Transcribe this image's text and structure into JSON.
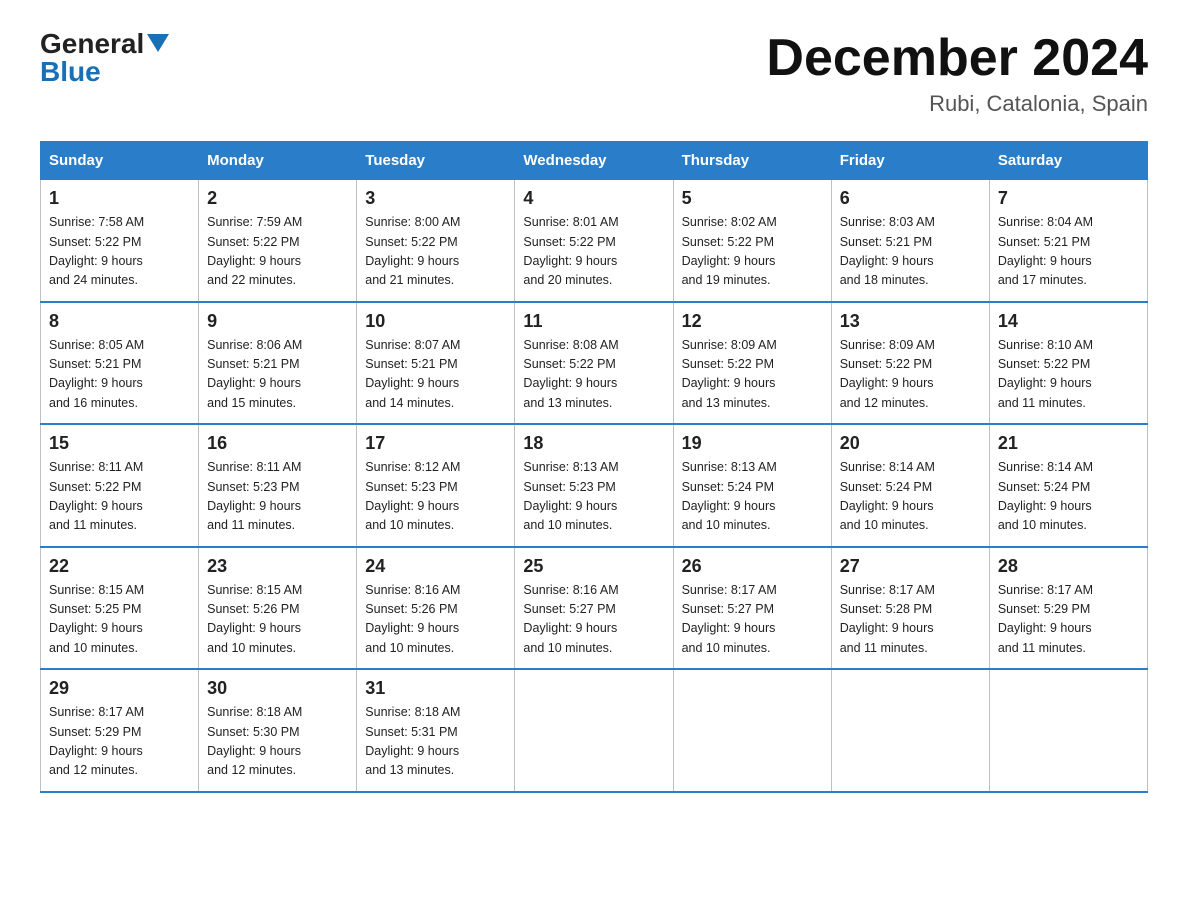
{
  "header": {
    "logo_general": "General",
    "logo_blue": "Blue",
    "main_title": "December 2024",
    "subtitle": "Rubi, Catalonia, Spain"
  },
  "days_of_week": [
    "Sunday",
    "Monday",
    "Tuesday",
    "Wednesday",
    "Thursday",
    "Friday",
    "Saturday"
  ],
  "weeks": [
    [
      {
        "num": "1",
        "sunrise": "7:58 AM",
        "sunset": "5:22 PM",
        "daylight": "9 hours and 24 minutes."
      },
      {
        "num": "2",
        "sunrise": "7:59 AM",
        "sunset": "5:22 PM",
        "daylight": "9 hours and 22 minutes."
      },
      {
        "num": "3",
        "sunrise": "8:00 AM",
        "sunset": "5:22 PM",
        "daylight": "9 hours and 21 minutes."
      },
      {
        "num": "4",
        "sunrise": "8:01 AM",
        "sunset": "5:22 PM",
        "daylight": "9 hours and 20 minutes."
      },
      {
        "num": "5",
        "sunrise": "8:02 AM",
        "sunset": "5:22 PM",
        "daylight": "9 hours and 19 minutes."
      },
      {
        "num": "6",
        "sunrise": "8:03 AM",
        "sunset": "5:21 PM",
        "daylight": "9 hours and 18 minutes."
      },
      {
        "num": "7",
        "sunrise": "8:04 AM",
        "sunset": "5:21 PM",
        "daylight": "9 hours and 17 minutes."
      }
    ],
    [
      {
        "num": "8",
        "sunrise": "8:05 AM",
        "sunset": "5:21 PM",
        "daylight": "9 hours and 16 minutes."
      },
      {
        "num": "9",
        "sunrise": "8:06 AM",
        "sunset": "5:21 PM",
        "daylight": "9 hours and 15 minutes."
      },
      {
        "num": "10",
        "sunrise": "8:07 AM",
        "sunset": "5:21 PM",
        "daylight": "9 hours and 14 minutes."
      },
      {
        "num": "11",
        "sunrise": "8:08 AM",
        "sunset": "5:22 PM",
        "daylight": "9 hours and 13 minutes."
      },
      {
        "num": "12",
        "sunrise": "8:09 AM",
        "sunset": "5:22 PM",
        "daylight": "9 hours and 13 minutes."
      },
      {
        "num": "13",
        "sunrise": "8:09 AM",
        "sunset": "5:22 PM",
        "daylight": "9 hours and 12 minutes."
      },
      {
        "num": "14",
        "sunrise": "8:10 AM",
        "sunset": "5:22 PM",
        "daylight": "9 hours and 11 minutes."
      }
    ],
    [
      {
        "num": "15",
        "sunrise": "8:11 AM",
        "sunset": "5:22 PM",
        "daylight": "9 hours and 11 minutes."
      },
      {
        "num": "16",
        "sunrise": "8:11 AM",
        "sunset": "5:23 PM",
        "daylight": "9 hours and 11 minutes."
      },
      {
        "num": "17",
        "sunrise": "8:12 AM",
        "sunset": "5:23 PM",
        "daylight": "9 hours and 10 minutes."
      },
      {
        "num": "18",
        "sunrise": "8:13 AM",
        "sunset": "5:23 PM",
        "daylight": "9 hours and 10 minutes."
      },
      {
        "num": "19",
        "sunrise": "8:13 AM",
        "sunset": "5:24 PM",
        "daylight": "9 hours and 10 minutes."
      },
      {
        "num": "20",
        "sunrise": "8:14 AM",
        "sunset": "5:24 PM",
        "daylight": "9 hours and 10 minutes."
      },
      {
        "num": "21",
        "sunrise": "8:14 AM",
        "sunset": "5:24 PM",
        "daylight": "9 hours and 10 minutes."
      }
    ],
    [
      {
        "num": "22",
        "sunrise": "8:15 AM",
        "sunset": "5:25 PM",
        "daylight": "9 hours and 10 minutes."
      },
      {
        "num": "23",
        "sunrise": "8:15 AM",
        "sunset": "5:26 PM",
        "daylight": "9 hours and 10 minutes."
      },
      {
        "num": "24",
        "sunrise": "8:16 AM",
        "sunset": "5:26 PM",
        "daylight": "9 hours and 10 minutes."
      },
      {
        "num": "25",
        "sunrise": "8:16 AM",
        "sunset": "5:27 PM",
        "daylight": "9 hours and 10 minutes."
      },
      {
        "num": "26",
        "sunrise": "8:17 AM",
        "sunset": "5:27 PM",
        "daylight": "9 hours and 10 minutes."
      },
      {
        "num": "27",
        "sunrise": "8:17 AM",
        "sunset": "5:28 PM",
        "daylight": "9 hours and 11 minutes."
      },
      {
        "num": "28",
        "sunrise": "8:17 AM",
        "sunset": "5:29 PM",
        "daylight": "9 hours and 11 minutes."
      }
    ],
    [
      {
        "num": "29",
        "sunrise": "8:17 AM",
        "sunset": "5:29 PM",
        "daylight": "9 hours and 12 minutes."
      },
      {
        "num": "30",
        "sunrise": "8:18 AM",
        "sunset": "5:30 PM",
        "daylight": "9 hours and 12 minutes."
      },
      {
        "num": "31",
        "sunrise": "8:18 AM",
        "sunset": "5:31 PM",
        "daylight": "9 hours and 13 minutes."
      },
      null,
      null,
      null,
      null
    ]
  ],
  "labels": {
    "sunrise": "Sunrise:",
    "sunset": "Sunset:",
    "daylight": "Daylight:"
  }
}
